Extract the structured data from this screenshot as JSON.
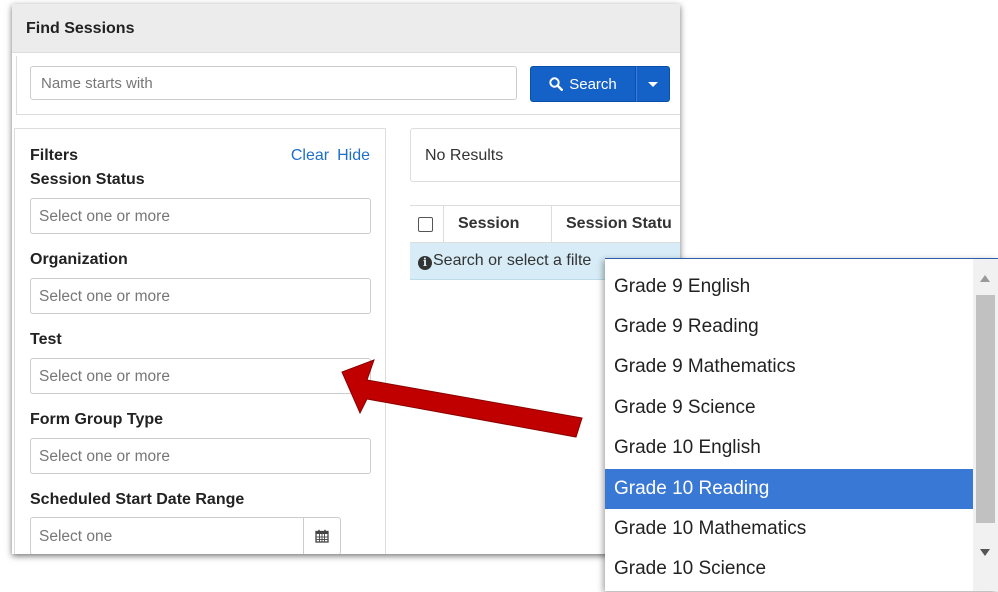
{
  "find_sessions": {
    "title": "Find Sessions",
    "search_placeholder": "Name starts with",
    "search_label": "Search"
  },
  "filters": {
    "title": "Filters",
    "clear": "Clear",
    "hide": "Hide",
    "session_status": {
      "label": "Session Status",
      "placeholder": "Select one or more"
    },
    "organization": {
      "label": "Organization",
      "placeholder": "Select one or more"
    },
    "test": {
      "label": "Test",
      "placeholder": "Select one or more"
    },
    "form_group_type": {
      "label": "Form Group Type",
      "placeholder": "Select one or more"
    },
    "date_range": {
      "label": "Scheduled Start Date Range",
      "placeholder": "Select one"
    }
  },
  "results": {
    "status": "No Results",
    "columns": [
      "Session",
      "Session Statu"
    ],
    "info": "Search or select a filte"
  },
  "dropdown": {
    "options": [
      "Grade 9 English",
      "Grade 9 Reading",
      "Grade 9 Mathematics",
      "Grade 9 Science",
      "Grade 10 English",
      "Grade 10 Reading",
      "Grade 10 Mathematics",
      "Grade 10 Science"
    ],
    "selected": "Grade 10 Reading"
  },
  "colors": {
    "primary_button": "#1461c7",
    "link": "#1f6fc9",
    "selected_option": "#3a78d6",
    "annotation_arrow": "#c00000",
    "info_row": "#d7ecf6"
  },
  "icons": {
    "search": "search-icon",
    "calendar": "calendar-icon",
    "info": "info-icon",
    "caret": "caret-down-icon"
  }
}
